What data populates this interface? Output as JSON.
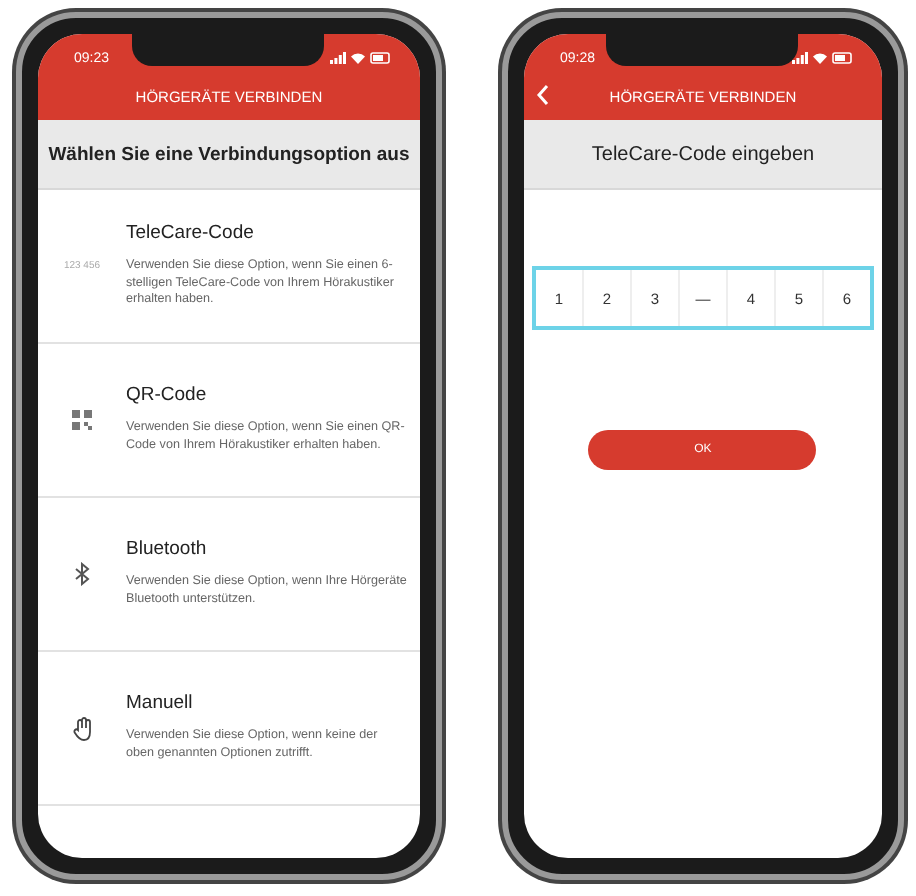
{
  "phones": [
    {
      "status_time": "09:23",
      "back": false,
      "title": "HÖRGERÄTE VERBINDEN",
      "subtitle": "Wählen Sie eine Verbindungsoption aus",
      "options": [
        {
          "kind": "code",
          "icon_text": "123 456",
          "title": "TeleCare-Code",
          "description": "Verwenden Sie diese Option, wenn Sie einen 6-stelligen TeleCare-Code von Ihrem Hörakustiker erhalten haben."
        },
        {
          "kind": "qr",
          "title": "QR-Code",
          "description": "Verwenden Sie diese Option, wenn Sie einen QR-Code von Ihrem Hörakustiker erhalten haben."
        },
        {
          "kind": "bluetooth",
          "title": "Bluetooth",
          "description": "Verwenden Sie diese Option, wenn Ihre Hörgeräte Bluetooth unterstützen."
        },
        {
          "kind": "hand",
          "title": "Manuell",
          "description": "Verwenden Sie diese Option, wenn keine der oben genannten Optionen zutrifft."
        }
      ]
    },
    {
      "status_time": "09:28",
      "back": true,
      "title": "HÖRGERÄTE VERBINDEN",
      "subtitle": "TeleCare-Code eingeben",
      "code_digits": [
        "1",
        "2",
        "3",
        "—",
        "4",
        "5",
        "6"
      ],
      "button": "OK"
    }
  ]
}
